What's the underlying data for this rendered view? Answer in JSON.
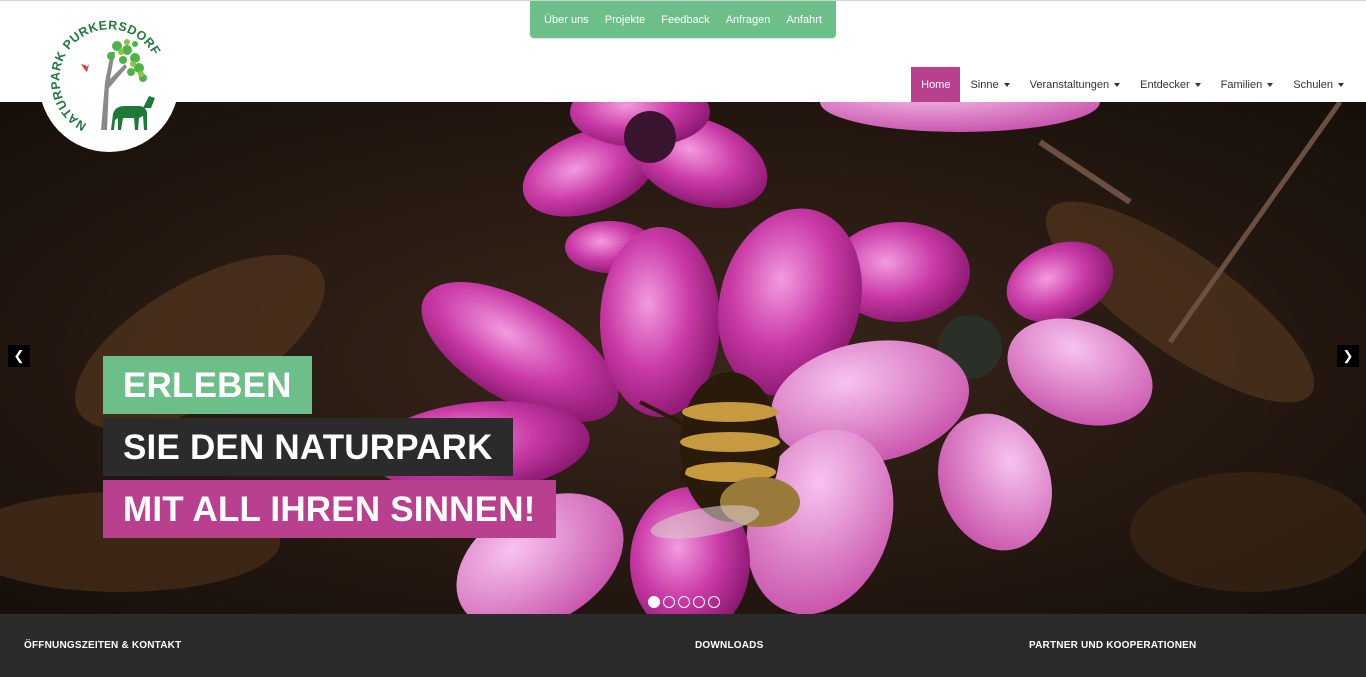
{
  "topnav": {
    "items": [
      "Über uns",
      "Projekte",
      "Feedback",
      "Anfragen",
      "Anfahrt"
    ]
  },
  "logo": {
    "text": "NATURPARK PURKERSDORF"
  },
  "mainnav": {
    "items": [
      {
        "label": "Home",
        "active": true,
        "dropdown": false
      },
      {
        "label": "Sinne",
        "active": false,
        "dropdown": true
      },
      {
        "label": "Veranstaltungen",
        "active": false,
        "dropdown": true
      },
      {
        "label": "Entdecker",
        "active": false,
        "dropdown": true
      },
      {
        "label": "Familien",
        "active": false,
        "dropdown": true
      },
      {
        "label": "Schulen",
        "active": false,
        "dropdown": true
      }
    ]
  },
  "hero": {
    "caption_line1": "ERLEBEN",
    "caption_line2": "SIE DEN NATURPARK",
    "caption_line3": "MIT ALL IHREN SINNEN!",
    "prev_icon": "chevron-left-icon",
    "next_icon": "chevron-right-icon",
    "slide_count": 5,
    "active_slide": 1
  },
  "footer": {
    "col1_title": "ÖFFNUNGSZEITEN & KONTAKT",
    "col2_title": "DOWNLOADS",
    "col3_title": "PARTNER UND KOOPERATIONEN"
  },
  "colors": {
    "green": "#6dbf89",
    "magenta": "#b8408f",
    "dark": "#2b2b2b"
  }
}
